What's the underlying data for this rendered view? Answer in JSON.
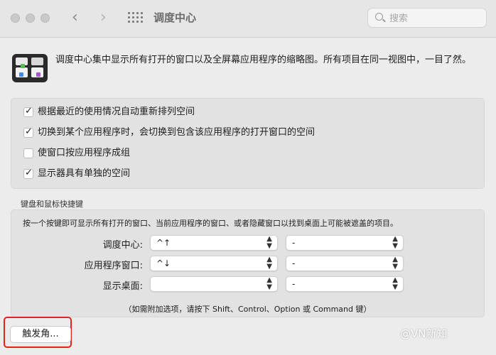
{
  "window": {
    "title": "调度中心",
    "search_placeholder": "搜索"
  },
  "header": {
    "description": "调度中心集中显示所有打开的窗口以及全屏幕应用程序的缩略图。所有项目在同一视图中，一目了然。"
  },
  "options": [
    {
      "label": "根据最近的使用情况自动重新排列空间",
      "checked": true
    },
    {
      "label": "切换到某个应用程序时，会切换到包含该应用程序的打开窗口的空间",
      "checked": true
    },
    {
      "label": "使窗口按应用程序成组",
      "checked": false
    },
    {
      "label": "显示器具有单独的空间",
      "checked": true
    }
  ],
  "shortcuts": {
    "section_title": "键盘和鼠标快捷键",
    "description": "按一个按键即可显示所有打开的窗口、当前应用程序的窗口、或者隐藏窗口以找到桌面上可能被遮盖的项目。",
    "rows": [
      {
        "label": "调度中心:",
        "key": "^↑",
        "mouse": "-"
      },
      {
        "label": "应用程序窗口:",
        "key": "^↓",
        "mouse": "-"
      },
      {
        "label": "显示桌面:",
        "key": "",
        "mouse": "-"
      }
    ],
    "note": "（如需附加选项，请按下 Shift、Control、Option 或 Command 键）"
  },
  "footer": {
    "hot_corners_label": "触发角..."
  },
  "watermark": "@VN新知",
  "colors": {
    "highlight_frame": "#e2241c",
    "background": "#ececec"
  }
}
